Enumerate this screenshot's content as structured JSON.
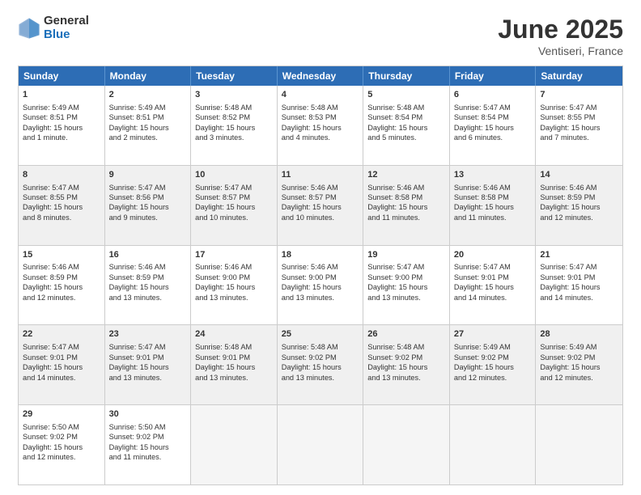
{
  "header": {
    "logo_general": "General",
    "logo_blue": "Blue",
    "title": "June 2025",
    "location": "Ventiseri, France"
  },
  "weekdays": [
    "Sunday",
    "Monday",
    "Tuesday",
    "Wednesday",
    "Thursday",
    "Friday",
    "Saturday"
  ],
  "rows": [
    [
      {
        "day": "1",
        "lines": [
          "Sunrise: 5:49 AM",
          "Sunset: 8:51 PM",
          "Daylight: 15 hours",
          "and 1 minute."
        ]
      },
      {
        "day": "2",
        "lines": [
          "Sunrise: 5:49 AM",
          "Sunset: 8:51 PM",
          "Daylight: 15 hours",
          "and 2 minutes."
        ]
      },
      {
        "day": "3",
        "lines": [
          "Sunrise: 5:48 AM",
          "Sunset: 8:52 PM",
          "Daylight: 15 hours",
          "and 3 minutes."
        ]
      },
      {
        "day": "4",
        "lines": [
          "Sunrise: 5:48 AM",
          "Sunset: 8:53 PM",
          "Daylight: 15 hours",
          "and 4 minutes."
        ]
      },
      {
        "day": "5",
        "lines": [
          "Sunrise: 5:48 AM",
          "Sunset: 8:54 PM",
          "Daylight: 15 hours",
          "and 5 minutes."
        ]
      },
      {
        "day": "6",
        "lines": [
          "Sunrise: 5:47 AM",
          "Sunset: 8:54 PM",
          "Daylight: 15 hours",
          "and 6 minutes."
        ]
      },
      {
        "day": "7",
        "lines": [
          "Sunrise: 5:47 AM",
          "Sunset: 8:55 PM",
          "Daylight: 15 hours",
          "and 7 minutes."
        ]
      }
    ],
    [
      {
        "day": "8",
        "lines": [
          "Sunrise: 5:47 AM",
          "Sunset: 8:55 PM",
          "Daylight: 15 hours",
          "and 8 minutes."
        ]
      },
      {
        "day": "9",
        "lines": [
          "Sunrise: 5:47 AM",
          "Sunset: 8:56 PM",
          "Daylight: 15 hours",
          "and 9 minutes."
        ]
      },
      {
        "day": "10",
        "lines": [
          "Sunrise: 5:47 AM",
          "Sunset: 8:57 PM",
          "Daylight: 15 hours",
          "and 10 minutes."
        ]
      },
      {
        "day": "11",
        "lines": [
          "Sunrise: 5:46 AM",
          "Sunset: 8:57 PM",
          "Daylight: 15 hours",
          "and 10 minutes."
        ]
      },
      {
        "day": "12",
        "lines": [
          "Sunrise: 5:46 AM",
          "Sunset: 8:58 PM",
          "Daylight: 15 hours",
          "and 11 minutes."
        ]
      },
      {
        "day": "13",
        "lines": [
          "Sunrise: 5:46 AM",
          "Sunset: 8:58 PM",
          "Daylight: 15 hours",
          "and 11 minutes."
        ]
      },
      {
        "day": "14",
        "lines": [
          "Sunrise: 5:46 AM",
          "Sunset: 8:59 PM",
          "Daylight: 15 hours",
          "and 12 minutes."
        ]
      }
    ],
    [
      {
        "day": "15",
        "lines": [
          "Sunrise: 5:46 AM",
          "Sunset: 8:59 PM",
          "Daylight: 15 hours",
          "and 12 minutes."
        ]
      },
      {
        "day": "16",
        "lines": [
          "Sunrise: 5:46 AM",
          "Sunset: 8:59 PM",
          "Daylight: 15 hours",
          "and 13 minutes."
        ]
      },
      {
        "day": "17",
        "lines": [
          "Sunrise: 5:46 AM",
          "Sunset: 9:00 PM",
          "Daylight: 15 hours",
          "and 13 minutes."
        ]
      },
      {
        "day": "18",
        "lines": [
          "Sunrise: 5:46 AM",
          "Sunset: 9:00 PM",
          "Daylight: 15 hours",
          "and 13 minutes."
        ]
      },
      {
        "day": "19",
        "lines": [
          "Sunrise: 5:47 AM",
          "Sunset: 9:00 PM",
          "Daylight: 15 hours",
          "and 13 minutes."
        ]
      },
      {
        "day": "20",
        "lines": [
          "Sunrise: 5:47 AM",
          "Sunset: 9:01 PM",
          "Daylight: 15 hours",
          "and 14 minutes."
        ]
      },
      {
        "day": "21",
        "lines": [
          "Sunrise: 5:47 AM",
          "Sunset: 9:01 PM",
          "Daylight: 15 hours",
          "and 14 minutes."
        ]
      }
    ],
    [
      {
        "day": "22",
        "lines": [
          "Sunrise: 5:47 AM",
          "Sunset: 9:01 PM",
          "Daylight: 15 hours",
          "and 14 minutes."
        ]
      },
      {
        "day": "23",
        "lines": [
          "Sunrise: 5:47 AM",
          "Sunset: 9:01 PM",
          "Daylight: 15 hours",
          "and 13 minutes."
        ]
      },
      {
        "day": "24",
        "lines": [
          "Sunrise: 5:48 AM",
          "Sunset: 9:01 PM",
          "Daylight: 15 hours",
          "and 13 minutes."
        ]
      },
      {
        "day": "25",
        "lines": [
          "Sunrise: 5:48 AM",
          "Sunset: 9:02 PM",
          "Daylight: 15 hours",
          "and 13 minutes."
        ]
      },
      {
        "day": "26",
        "lines": [
          "Sunrise: 5:48 AM",
          "Sunset: 9:02 PM",
          "Daylight: 15 hours",
          "and 13 minutes."
        ]
      },
      {
        "day": "27",
        "lines": [
          "Sunrise: 5:49 AM",
          "Sunset: 9:02 PM",
          "Daylight: 15 hours",
          "and 12 minutes."
        ]
      },
      {
        "day": "28",
        "lines": [
          "Sunrise: 5:49 AM",
          "Sunset: 9:02 PM",
          "Daylight: 15 hours",
          "and 12 minutes."
        ]
      }
    ],
    [
      {
        "day": "29",
        "lines": [
          "Sunrise: 5:50 AM",
          "Sunset: 9:02 PM",
          "Daylight: 15 hours",
          "and 12 minutes."
        ]
      },
      {
        "day": "30",
        "lines": [
          "Sunrise: 5:50 AM",
          "Sunset: 9:02 PM",
          "Daylight: 15 hours",
          "and 11 minutes."
        ]
      },
      {
        "day": "",
        "lines": []
      },
      {
        "day": "",
        "lines": []
      },
      {
        "day": "",
        "lines": []
      },
      {
        "day": "",
        "lines": []
      },
      {
        "day": "",
        "lines": []
      }
    ]
  ]
}
